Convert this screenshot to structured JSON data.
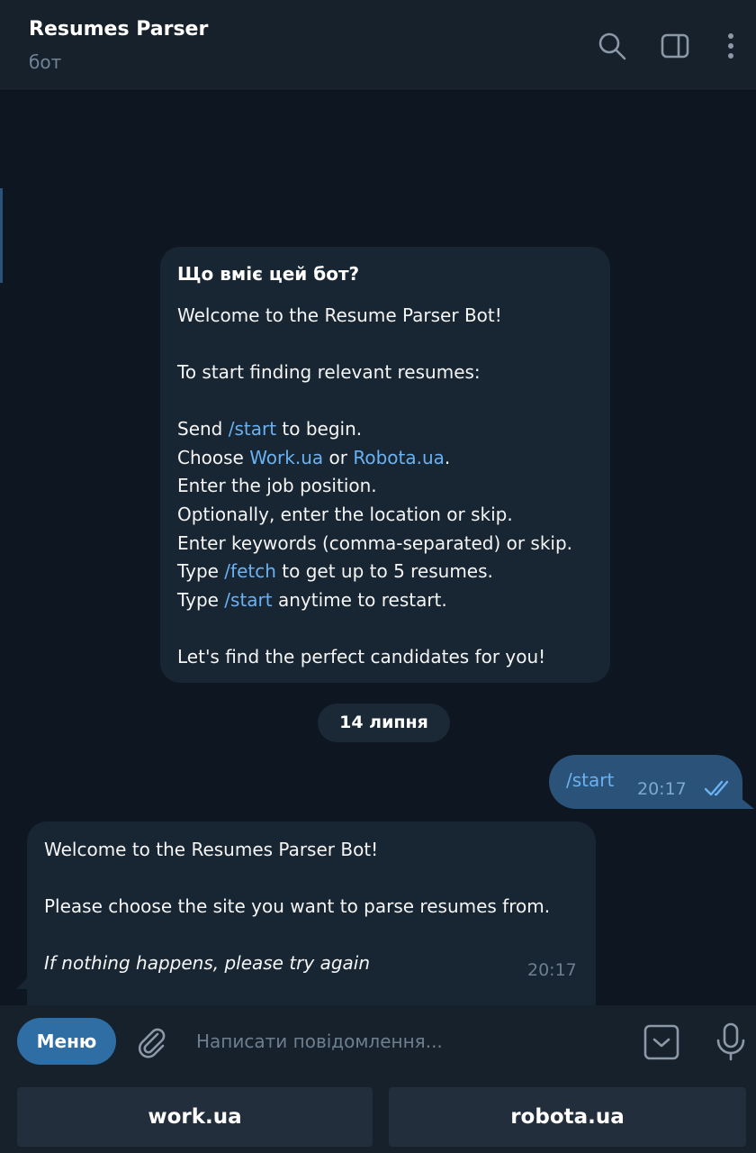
{
  "header": {
    "title": "Resumes Parser",
    "subtitle": "бот",
    "icons": [
      "search-icon",
      "sidebar-toggle-icon",
      "more-vertical-icon"
    ]
  },
  "intro": {
    "title": "Що вміє цей бот?",
    "welcome": "Welcome to the Resume Parser Bot!",
    "start_finding": "To start finding relevant resumes:",
    "step1": {
      "pre": "Send ",
      "cmd": "/start",
      "post": " to begin."
    },
    "step2": {
      "pre": "Choose ",
      "link1": "Work.ua",
      "mid": " or ",
      "link2": "Robota.ua",
      "post": "."
    },
    "step3": "Enter the job position.",
    "step4": "Optionally, enter the location or skip.",
    "step5": "Enter keywords (comma-separated) or skip.",
    "step6": {
      "pre": "Type ",
      "cmd": "/fetch",
      "post": " to get up to 5 resumes."
    },
    "step7": {
      "pre": "Type ",
      "cmd": "/start",
      "post": " anytime to restart."
    },
    "closing": "Let's find the perfect candidates for you!"
  },
  "date_separator": "14 липня",
  "outgoing": {
    "text": "/start",
    "time": "20:17",
    "status": "read"
  },
  "incoming": {
    "line1": "Welcome to the Resumes Parser Bot!",
    "line2": "Please choose the site you want to parse resumes from.",
    "line3": "If nothing happens, please try again",
    "time": "20:17"
  },
  "input": {
    "menu_label": "Меню",
    "placeholder": "Написати повідомлення..."
  },
  "keyboard": {
    "buttons": [
      "work.ua",
      "robota.ua"
    ]
  },
  "colors": {
    "background": "#0e1621",
    "header": "#17212b",
    "incoming_bubble": "#182533",
    "outgoing_bubble": "#2b5278",
    "link": "#6ab2f2",
    "menu_button": "#2f6ea5",
    "keyboard_button": "#232e3c"
  }
}
